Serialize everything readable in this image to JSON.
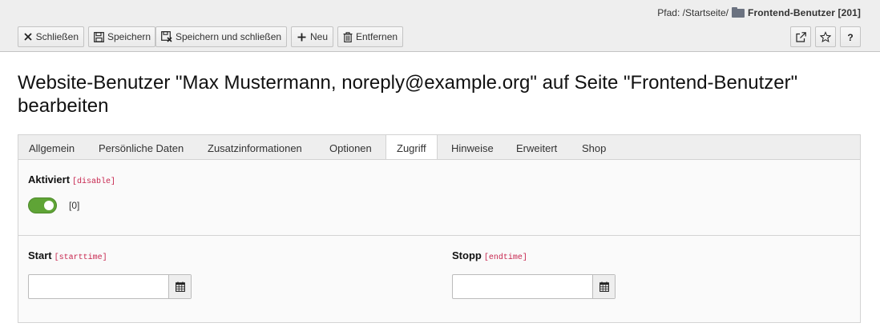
{
  "docheader": {
    "path_label": "Pfad: /Startseite/",
    "path_page": "Frontend-Benutzer [201]",
    "buttons": {
      "close": "Schließen",
      "save": "Speichern",
      "save_close": "Speichern und schließen",
      "new": "Neu",
      "delete": "Entfernen"
    }
  },
  "title": "Website-Benutzer \"Max Mustermann, noreply@example.org\" auf Seite \"Frontend-Benutzer\" bearbeiten",
  "tabs": [
    {
      "label": "Allgemein"
    },
    {
      "label": "Persönliche Daten"
    },
    {
      "label": "Zusatzinformationen"
    },
    {
      "label": "Optionen"
    },
    {
      "label": "Zugriff"
    },
    {
      "label": "Hinweise"
    },
    {
      "label": "Erweitert"
    },
    {
      "label": "Shop"
    }
  ],
  "active_tab": "Zugriff",
  "fields": {
    "disable": {
      "label": "Aktiviert",
      "field_name": "[disable]",
      "value_text": "[0]",
      "enabled": true
    },
    "starttime": {
      "label": "Start",
      "field_name": "[starttime]",
      "value": ""
    },
    "endtime": {
      "label": "Stopp",
      "field_name": "[endtime]",
      "value": ""
    }
  },
  "colors": {
    "toggle_on": "#5fa436",
    "field_name": "#c7254e",
    "header_bg": "#eeeeee"
  }
}
